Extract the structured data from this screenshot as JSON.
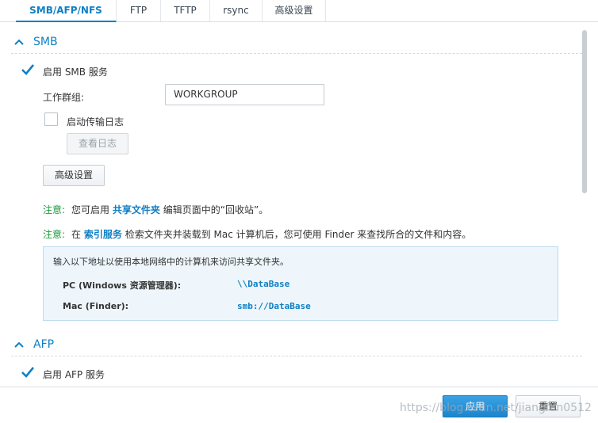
{
  "tabs": [
    {
      "label": "SMB/AFP/NFS",
      "active": true
    },
    {
      "label": "FTP",
      "active": false
    },
    {
      "label": "TFTP",
      "active": false
    },
    {
      "label": "rsync",
      "active": false
    },
    {
      "label": "高级设置",
      "active": false
    }
  ],
  "smb": {
    "section_title": "SMB",
    "enable_label": "启用 SMB 服务",
    "enable_checked": true,
    "workgroup_label": "工作群组:",
    "workgroup_value": "WORKGROUP",
    "transfer_log_label": "启动传输日志",
    "transfer_log_checked": false,
    "view_log_button": "查看日志",
    "advanced_button": "高级设置",
    "note1": {
      "tag": "注意:",
      "prefix": "您可启用",
      "link": "共享文件夹",
      "suffix": "编辑页面中的“回收站”。"
    },
    "note2": {
      "tag": "注意:",
      "prefix": "在",
      "link": "索引服务",
      "suffix": "检索文件夹并装载到 Mac 计算机后，您可使用 Finder 来查找所合的文件和内容。"
    },
    "info": {
      "intro": "输入以下地址以使用本地网络中的计算机来访问共享文件夹。",
      "pc_label": "PC (Windows 资源管理器):",
      "pc_value": "\\\\DataBase",
      "mac_label": "Mac (Finder):",
      "mac_value": "smb://DataBase"
    }
  },
  "afp": {
    "section_title": "AFP",
    "enable_label": "启用 AFP 服务",
    "enable_checked": true
  },
  "footer": {
    "apply_button": "应用",
    "reset_button": "重置",
    "watermark": "https://blog.csdn.net/jiangfan0512"
  },
  "colors": {
    "accent": "#0e7fc4",
    "note_tag": "#1a9a3c",
    "info_bg": "#eef6fb"
  }
}
